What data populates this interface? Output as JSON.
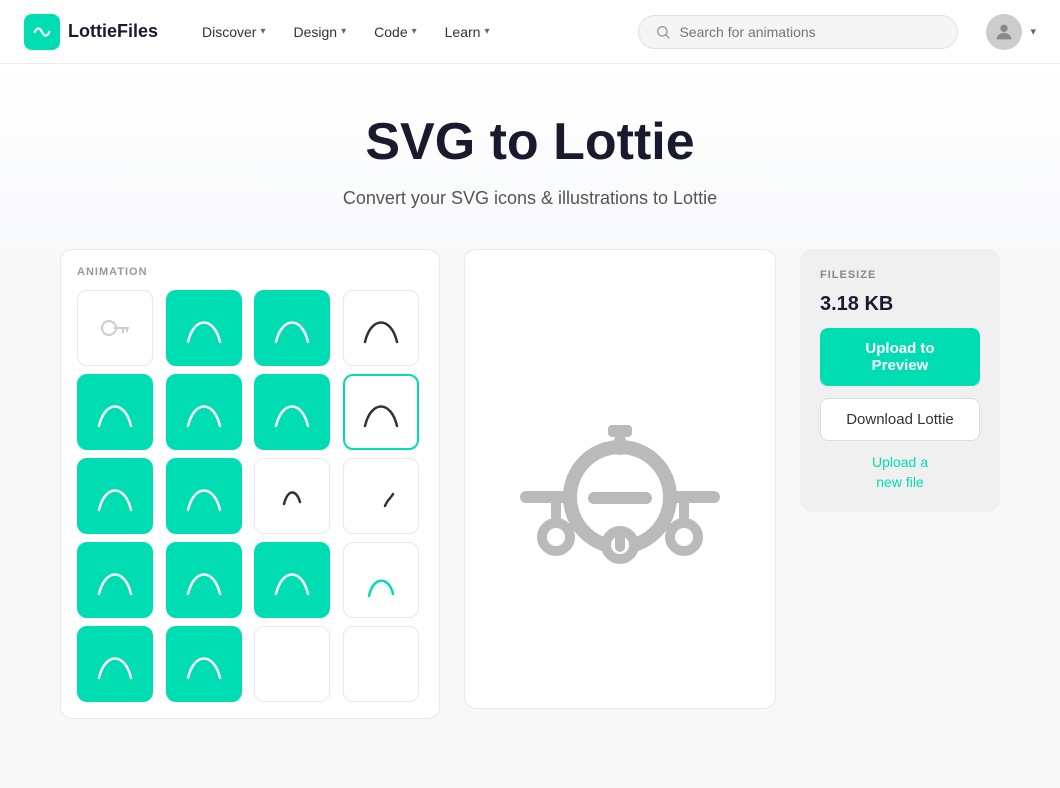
{
  "navbar": {
    "logo_text": "LottieFiles",
    "nav_items": [
      {
        "label": "Discover",
        "has_chevron": true
      },
      {
        "label": "Design",
        "has_chevron": true
      },
      {
        "label": "Code",
        "has_chevron": true
      },
      {
        "label": "Learn",
        "has_chevron": true
      }
    ],
    "search_placeholder": "Search for animations"
  },
  "hero": {
    "title": "SVG to Lottie",
    "subtitle": "Convert your SVG icons & illustrations to Lottie"
  },
  "left_panel": {
    "label": "ANIMATION",
    "grid_rows": 5
  },
  "right_panel": {
    "filesize_label": "FILESIZE",
    "filesize_value": "3.18 KB",
    "upload_btn": "Upload to Preview",
    "download_btn": "Download Lottie",
    "upload_new": "Upload a\nnew file"
  },
  "colors": {
    "teal": "#00DDB3",
    "dark": "#1a1a2e"
  }
}
